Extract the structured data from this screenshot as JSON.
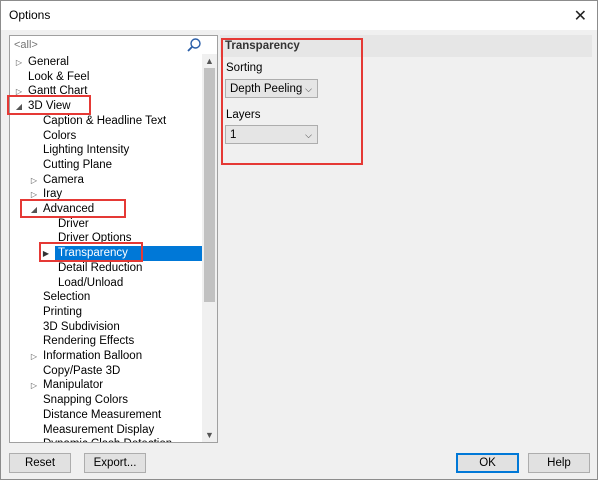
{
  "window": {
    "title": "Options",
    "close_glyph": "✕"
  },
  "search": {
    "placeholder": "<all>"
  },
  "tree": {
    "items": [
      {
        "label": "General",
        "expander": "▷"
      },
      {
        "label": "Look & Feel",
        "expander": ""
      },
      {
        "label": "Gantt Chart",
        "expander": "▷"
      },
      {
        "label": "3D View",
        "expander": "◢"
      },
      {
        "label": "Caption & Headline Text",
        "expander": ""
      },
      {
        "label": "Colors",
        "expander": ""
      },
      {
        "label": "Lighting Intensity",
        "expander": ""
      },
      {
        "label": "Cutting Plane",
        "expander": ""
      },
      {
        "label": "Camera",
        "expander": "▷"
      },
      {
        "label": "Iray",
        "expander": "▷"
      },
      {
        "label": "Advanced",
        "expander": "◢"
      },
      {
        "label": "Driver",
        "expander": ""
      },
      {
        "label": "Driver Options",
        "expander": ""
      },
      {
        "label": "Transparency",
        "expander": "▶"
      },
      {
        "label": "Detail Reduction",
        "expander": ""
      },
      {
        "label": "Load/Unload",
        "expander": ""
      },
      {
        "label": "Selection",
        "expander": ""
      },
      {
        "label": "Printing",
        "expander": ""
      },
      {
        "label": "3D Subdivision",
        "expander": ""
      },
      {
        "label": "Rendering Effects",
        "expander": ""
      },
      {
        "label": "Information Balloon",
        "expander": "▷"
      },
      {
        "label": "Copy/Paste 3D",
        "expander": ""
      },
      {
        "label": "Manipulator",
        "expander": "▷"
      },
      {
        "label": "Snapping Colors",
        "expander": ""
      },
      {
        "label": "Distance Measurement",
        "expander": ""
      },
      {
        "label": "Measurement Display",
        "expander": ""
      },
      {
        "label": "Dynamic Clash Detection",
        "expander": ""
      }
    ],
    "selected_label": "Transparency"
  },
  "scrollbar": {
    "up": "▲",
    "down": "▼"
  },
  "settings": {
    "section_title": "Transparency",
    "sorting_label": "Sorting",
    "sorting_value": "Depth Peeling",
    "layers_label": "Layers",
    "layers_value": "1",
    "chevron": "⌵"
  },
  "buttons": {
    "reset": "Reset",
    "export": "Export...",
    "ok": "OK",
    "help": "Help"
  },
  "colors": {
    "selection": "#0078d7",
    "highlight": "#e53935"
  }
}
